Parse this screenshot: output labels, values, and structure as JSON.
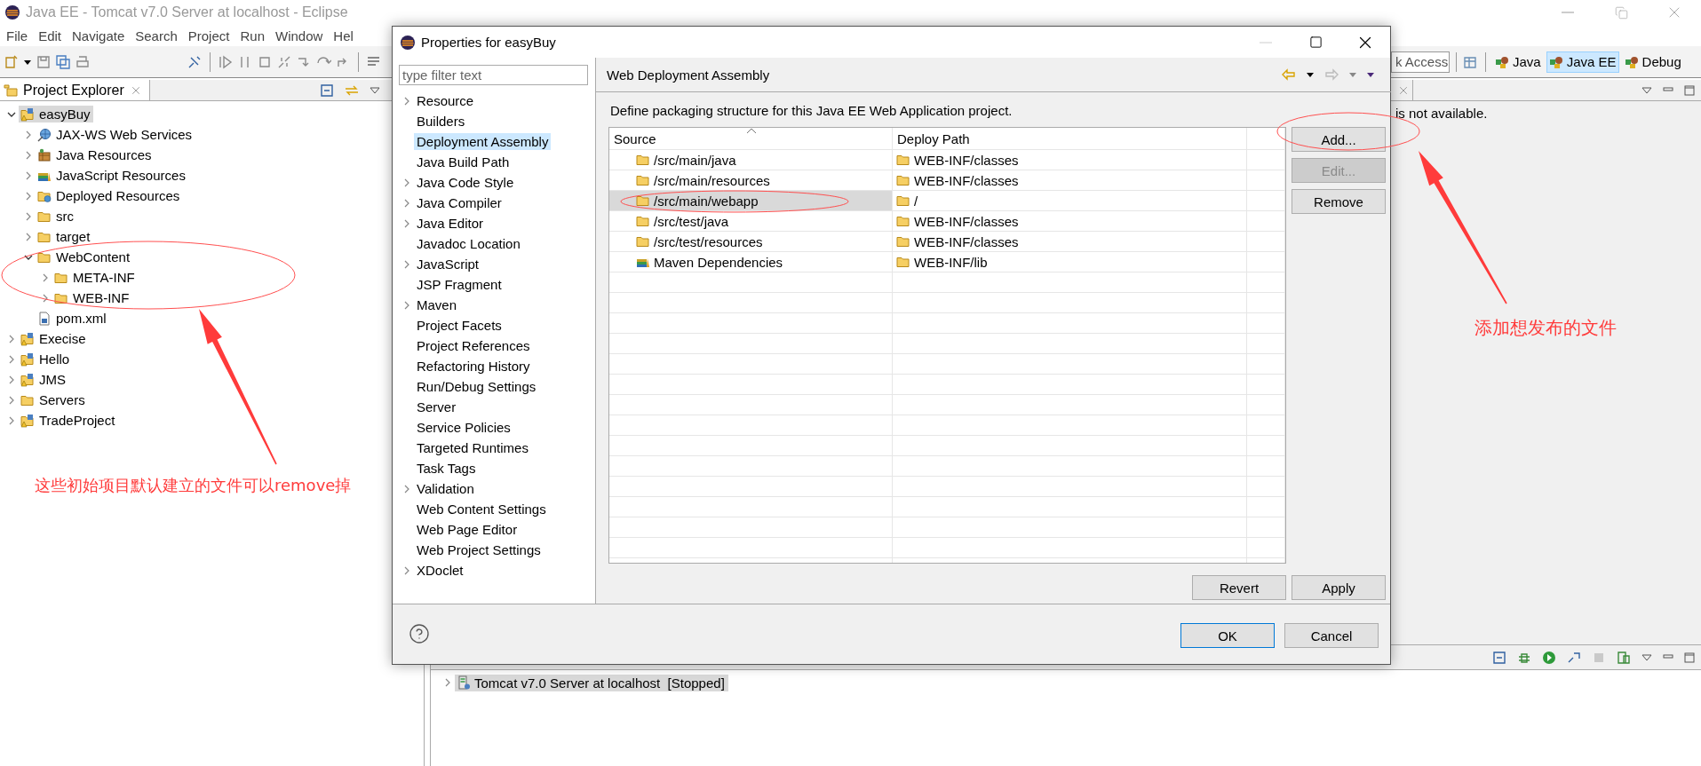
{
  "window": {
    "title": "Java EE - Tomcat v7.0 Server at localhost - Eclipse"
  },
  "menu": [
    "File",
    "Edit",
    "Navigate",
    "Search",
    "Project",
    "Run",
    "Window",
    "Hel"
  ],
  "quick_access": {
    "placeholder": "k Access"
  },
  "perspectives": [
    {
      "label": "Java",
      "selected": false
    },
    {
      "label": "Java EE",
      "selected": true
    },
    {
      "label": "Debug",
      "selected": false
    }
  ],
  "explorer": {
    "title": "Project Explorer",
    "tree": [
      {
        "label": "easyBuy",
        "kind": "project",
        "expandable": true,
        "expanded": true,
        "selected": true,
        "children": [
          {
            "label": "JAX-WS Web Services",
            "kind": "globe",
            "expandable": true,
            "expanded": false,
            "selected": false
          },
          {
            "label": "Java Resources",
            "kind": "package",
            "expandable": true,
            "expanded": false,
            "selected": false
          },
          {
            "label": "JavaScript Resources",
            "kind": "books",
            "expandable": true,
            "expanded": false,
            "selected": false
          },
          {
            "label": "Deployed Resources",
            "kind": "folder-globe",
            "expandable": true,
            "expanded": false,
            "selected": false
          },
          {
            "label": "src",
            "kind": "folder",
            "expandable": true,
            "expanded": false,
            "selected": false
          },
          {
            "label": "target",
            "kind": "folder",
            "expandable": true,
            "expanded": false,
            "selected": false
          },
          {
            "label": "WebContent",
            "kind": "folder",
            "expandable": true,
            "expanded": true,
            "selected": false,
            "children": [
              {
                "label": "META-INF",
                "kind": "folder",
                "expandable": true,
                "expanded": false,
                "selected": false
              },
              {
                "label": "WEB-INF",
                "kind": "folder",
                "expandable": true,
                "expanded": false,
                "selected": false
              }
            ]
          },
          {
            "label": "pom.xml",
            "kind": "file",
            "expandable": false,
            "expanded": false,
            "selected": false
          }
        ]
      },
      {
        "label": "Execise",
        "kind": "project",
        "expandable": true,
        "expanded": false,
        "selected": false
      },
      {
        "label": "Hello",
        "kind": "project",
        "expandable": true,
        "expanded": false,
        "selected": false
      },
      {
        "label": "JMS",
        "kind": "project",
        "expandable": true,
        "expanded": false,
        "selected": false
      },
      {
        "label": "Servers",
        "kind": "folder",
        "expandable": true,
        "expanded": false,
        "selected": false
      },
      {
        "label": "TradeProject",
        "kind": "project",
        "expandable": true,
        "expanded": false,
        "selected": false
      }
    ]
  },
  "view": {
    "message": "is not available."
  },
  "servers": {
    "rows": [
      {
        "label": "Tomcat v7.0 Server at localhost  [Stopped]",
        "expanded": false,
        "selected": true
      }
    ]
  },
  "dialog": {
    "title": "Properties for easyBuy",
    "filter": {
      "placeholder": "type filter text"
    },
    "nav": [
      {
        "label": "Resource",
        "expandable": true,
        "selected": false
      },
      {
        "label": "Builders",
        "expandable": false,
        "selected": false
      },
      {
        "label": "Deployment Assembly",
        "expandable": false,
        "selected": true
      },
      {
        "label": "Java Build Path",
        "expandable": false,
        "selected": false
      },
      {
        "label": "Java Code Style",
        "expandable": true,
        "selected": false
      },
      {
        "label": "Java Compiler",
        "expandable": true,
        "selected": false
      },
      {
        "label": "Java Editor",
        "expandable": true,
        "selected": false
      },
      {
        "label": "Javadoc Location",
        "expandable": false,
        "selected": false
      },
      {
        "label": "JavaScript",
        "expandable": true,
        "selected": false
      },
      {
        "label": "JSP Fragment",
        "expandable": false,
        "selected": false
      },
      {
        "label": "Maven",
        "expandable": true,
        "selected": false
      },
      {
        "label": "Project Facets",
        "expandable": false,
        "selected": false
      },
      {
        "label": "Project References",
        "expandable": false,
        "selected": false
      },
      {
        "label": "Refactoring History",
        "expandable": false,
        "selected": false
      },
      {
        "label": "Run/Debug Settings",
        "expandable": false,
        "selected": false
      },
      {
        "label": "Server",
        "expandable": false,
        "selected": false
      },
      {
        "label": "Service Policies",
        "expandable": false,
        "selected": false
      },
      {
        "label": "Targeted Runtimes",
        "expandable": false,
        "selected": false
      },
      {
        "label": "Task Tags",
        "expandable": false,
        "selected": false
      },
      {
        "label": "Validation",
        "expandable": true,
        "selected": false
      },
      {
        "label": "Web Content Settings",
        "expandable": false,
        "selected": false
      },
      {
        "label": "Web Page Editor",
        "expandable": false,
        "selected": false
      },
      {
        "label": "Web Project Settings",
        "expandable": false,
        "selected": false
      },
      {
        "label": "XDoclet",
        "expandable": true,
        "selected": false
      }
    ],
    "page_title": "Web Deployment Assembly",
    "description": "Define packaging structure for this Java EE Web Application project.",
    "columns": [
      "Source",
      "Deploy Path"
    ],
    "rows": [
      {
        "source": "/src/main/java",
        "deploy_path": "WEB-INF/classes",
        "kind": "folder",
        "selected": false
      },
      {
        "source": "/src/main/resources",
        "deploy_path": "WEB-INF/classes",
        "kind": "folder",
        "selected": false
      },
      {
        "source": "/src/main/webapp",
        "deploy_path": "/",
        "kind": "folder",
        "selected": true
      },
      {
        "source": "/src/test/java",
        "deploy_path": "WEB-INF/classes",
        "kind": "folder",
        "selected": false
      },
      {
        "source": "/src/test/resources",
        "deploy_path": "WEB-INF/classes",
        "kind": "folder",
        "selected": false
      },
      {
        "source": "Maven Dependencies",
        "deploy_path": "WEB-INF/lib",
        "kind": "library",
        "selected": false
      }
    ],
    "side_buttons": [
      {
        "label": "Add...",
        "disabled": false
      },
      {
        "label": "Edit...",
        "disabled": true
      },
      {
        "label": "Remove",
        "disabled": false
      }
    ],
    "page_buttons": [
      "Revert",
      "Apply"
    ],
    "footer_buttons": [
      {
        "label": "OK",
        "default": true
      },
      {
        "label": "Cancel",
        "default": false
      }
    ]
  },
  "annotations": [
    {
      "text": "这些初始项目默认建立的文件可以remove掉"
    },
    {
      "text": "添加想发布的文件"
    }
  ]
}
